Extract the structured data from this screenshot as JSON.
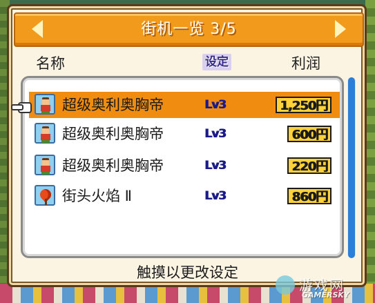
{
  "dialog": {
    "title": "街机一览 3/5",
    "prev_icon": "arrow-left-icon",
    "next_icon": "arrow-right-icon"
  },
  "columns": {
    "name": "名称",
    "setting": "设定",
    "profit": "利润"
  },
  "rows": [
    {
      "name": "超级奥利奥胸帝",
      "level": "Lv3",
      "profit": "1,250円",
      "icon": "fighter-icon",
      "selected": true
    },
    {
      "name": "超级奥利奥胸帝",
      "level": "Lv3",
      "profit": "600円",
      "icon": "fighter-icon",
      "selected": false
    },
    {
      "name": "超级奥利奥胸帝",
      "level": "Lv3",
      "profit": "220円",
      "icon": "fighter-icon",
      "selected": false
    },
    {
      "name": "街头火焰 Ⅱ",
      "level": "Lv3",
      "profit": "860円",
      "icon": "flame-icon",
      "selected": false
    }
  ],
  "footer": {
    "hint": "触摸以更改设定"
  },
  "watermark": {
    "cn": "游戏网",
    "en": "GAMERSKY"
  },
  "colors": {
    "title_bar": "#f29a1c",
    "selected_row": "#f08c10",
    "scrollbar": "#2b7fd8",
    "profit_badge": "#ffd23a"
  }
}
